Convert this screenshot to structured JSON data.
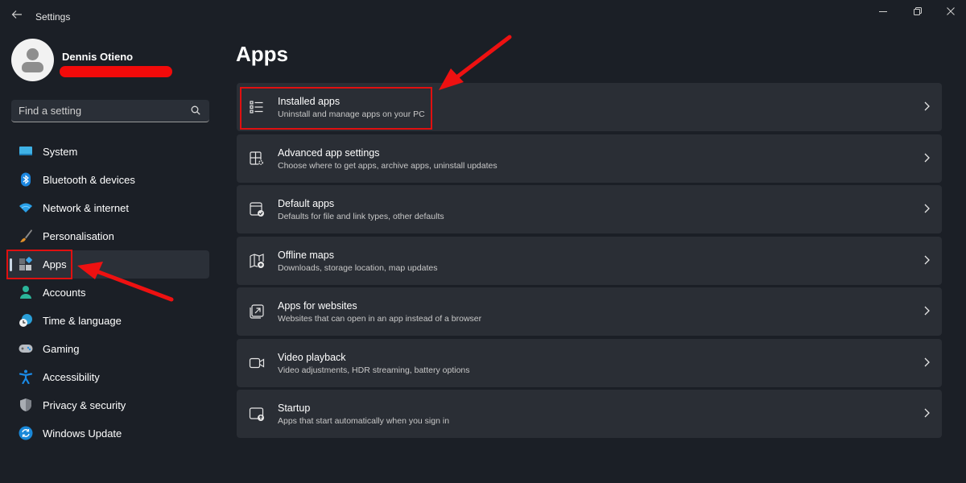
{
  "window": {
    "title": "Settings",
    "controls": {
      "minimize": "minimize-icon",
      "maximize": "restore-icon",
      "close": "close-icon"
    }
  },
  "profile": {
    "name": "Dennis Otieno"
  },
  "search": {
    "placeholder": "Find a setting",
    "value": ""
  },
  "sidebar": {
    "items": [
      {
        "label": "System",
        "icon": "system-icon"
      },
      {
        "label": "Bluetooth & devices",
        "icon": "bluetooth-icon"
      },
      {
        "label": "Network & internet",
        "icon": "wifi-icon"
      },
      {
        "label": "Personalisation",
        "icon": "brush-icon"
      },
      {
        "label": "Apps",
        "icon": "apps-icon",
        "active": true
      },
      {
        "label": "Accounts",
        "icon": "accounts-icon"
      },
      {
        "label": "Time & language",
        "icon": "time-language-icon"
      },
      {
        "label": "Gaming",
        "icon": "gaming-icon"
      },
      {
        "label": "Accessibility",
        "icon": "accessibility-icon"
      },
      {
        "label": "Privacy & security",
        "icon": "shield-icon"
      },
      {
        "label": "Windows Update",
        "icon": "update-icon"
      }
    ]
  },
  "main": {
    "title": "Apps",
    "cards": [
      {
        "title": "Installed apps",
        "subtitle": "Uninstall and manage apps on your PC",
        "icon": "list-icon"
      },
      {
        "title": "Advanced app settings",
        "subtitle": "Choose where to get apps, archive apps, uninstall updates",
        "icon": "app-settings-icon"
      },
      {
        "title": "Default apps",
        "subtitle": "Defaults for file and link types, other defaults",
        "icon": "default-apps-icon"
      },
      {
        "title": "Offline maps",
        "subtitle": "Downloads, storage location, map updates",
        "icon": "map-icon"
      },
      {
        "title": "Apps for websites",
        "subtitle": "Websites that can open in an app instead of a browser",
        "icon": "open-external-icon"
      },
      {
        "title": "Video playback",
        "subtitle": "Video adjustments, HDR streaming, battery options",
        "icon": "video-icon"
      },
      {
        "title": "Startup",
        "subtitle": "Apps that start automatically when you sign in",
        "icon": "startup-icon"
      }
    ]
  },
  "colors": {
    "background": "#1b1f26",
    "card": "#2a2e35",
    "annotation": "#e01010",
    "accent": "#4cc2ff"
  }
}
